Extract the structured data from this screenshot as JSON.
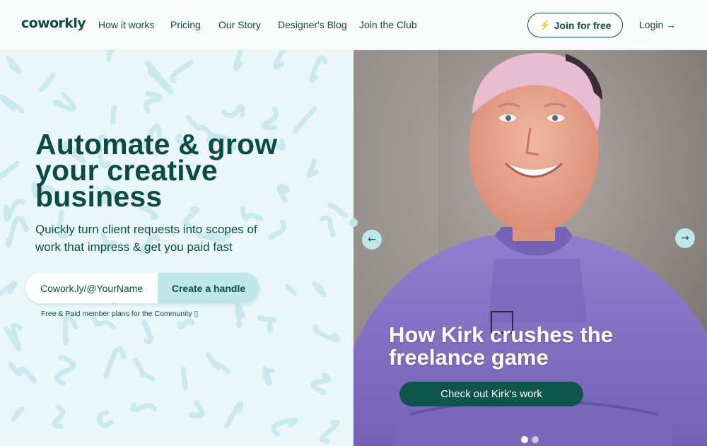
{
  "brand": {
    "logo_text": "coworkly"
  },
  "nav": {
    "links": [
      "How it works",
      "Pricing",
      "Our Story",
      "Designer's Blog",
      "Join the Club"
    ],
    "join_label": "Join for free",
    "join_icon": "lightning-bolt-icon",
    "login_label": "Login →"
  },
  "hero": {
    "headline": "Automate & grow your creative business",
    "subtext": "Quickly turn client requests into scopes of work that impress & get you paid fast",
    "handle_placeholder": "Cowork.ly/@YourName",
    "handle_button": "Create a handle",
    "plans_note": "Free & Paid member plans for the Community ▯"
  },
  "slider": {
    "title": "How Kirk crushes the freelance game",
    "cta_label": "Check out Kirk's work",
    "prev_icon": "arrow-left-icon",
    "next_icon": "arrow-right-icon",
    "active_index": 0,
    "dots": 2
  },
  "colors": {
    "brand_dark": "#0c4a44",
    "accent_light": "#bfe7ea",
    "cta_dark": "#0e554c",
    "hero_bg": "#e9f7fb",
    "sweater": "#8a78c8"
  }
}
